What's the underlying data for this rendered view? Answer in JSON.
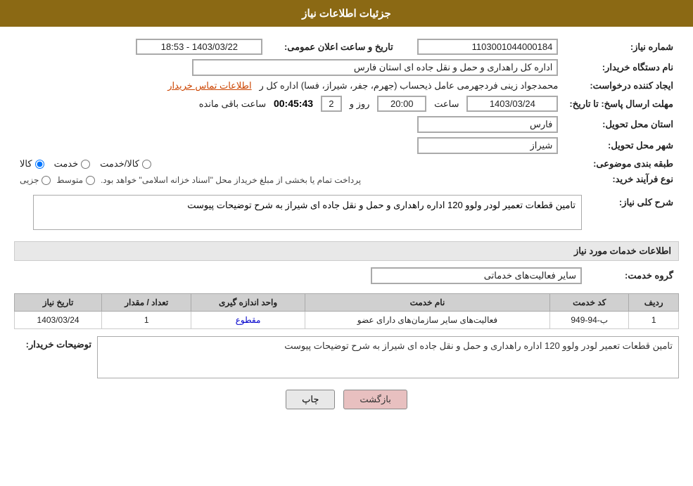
{
  "header": {
    "title": "جزئیات اطلاعات نیاز"
  },
  "fields": {
    "shomareNiaz_label": "شماره نیاز:",
    "shomareNiaz_value": "1103001044000184",
    "namDastgah_label": "نام دستگاه خریدار:",
    "namDastgah_value": "اداره کل راهداری و حمل و نقل جاده ای استان فارس",
    "ijadKonande_label": "ایجاد کننده درخواست:",
    "ijadKonande_value": "محمدجواد زینی فردجهرمی عامل ذیحساب (جهرم، جفر، شیراز، فسا) اداره کل ر",
    "etelaatTamas_label": "اطلاعات تماس خریدار",
    "mohlat_label": "مهلت ارسال پاسخ: تا تاریخ:",
    "date_value": "1403/03/24",
    "saat_label": "ساعت",
    "saat_value": "20:00",
    "roz_label": "روز و",
    "roz_value": "2",
    "baghimande_label": "ساعت باقی مانده",
    "baghimande_value": "00:45:43",
    "ostan_label": "استان محل تحویل:",
    "ostan_value": "فارس",
    "shahr_label": "شهر محل تحویل:",
    "shahr_value": "شیراز",
    "tabaqe_label": "طبقه بندی موضوعی:",
    "tabaqe_radio": [
      {
        "id": "kala",
        "label": "کالا",
        "checked": true
      },
      {
        "id": "khadamat",
        "label": "خدمت",
        "checked": false
      },
      {
        "id": "kala_khadamat",
        "label": "کالا/خدمت",
        "checked": false
      }
    ],
    "noeFarayand_label": "نوع فرآیند خرید:",
    "noeFarayand_radio": [
      {
        "id": "jozii",
        "label": "جزیی",
        "checked": false
      },
      {
        "id": "mootaset",
        "label": "متوسط",
        "checked": false
      }
    ],
    "noeFarayand_desc": "پرداخت تمام یا بخشی از مبلغ خریداز محل \"اسناد خزانه اسلامی\" خواهد بود.",
    "sharhNiaz_label": "شرح کلی نیاز:",
    "sharhNiaz_value": "تامین قطعات تعمیر لودر ولوو 120 اداره راهداری و حمل و نقل جاده ای شیراز به شرح توضیحات پیوست",
    "etelaatKhadamat_title": "اطلاعات خدمات مورد نیاز",
    "gorohKhadamat_label": "گروه خدمت:",
    "gorohKhadamat_value": "سایر فعالیت‌های خدماتی",
    "table": {
      "headers": [
        "ردیف",
        "کد خدمت",
        "نام خدمت",
        "واحد اندازه گیری",
        "تعداد / مقدار",
        "تاریخ نیاز"
      ],
      "rows": [
        {
          "radif": "1",
          "kodKhadamat": "ب-94-949",
          "namKhadamat": "فعالیت‌های سایر سازمان‌های دارای عضو",
          "vahed": "مقطوع",
          "tedad": "1",
          "tarikh": "1403/03/24"
        }
      ]
    },
    "tozihatKharidar_label": "توضیحات خریدار:",
    "tozihatKharidar_value": "تامین قطعات تعمیر لودر ولوو 120 اداره راهداری و حمل و نقل جاده ای شیراز به شرح توضیحات پیوست"
  },
  "buttons": {
    "print_label": "چاپ",
    "back_label": "بازگشت"
  },
  "tarikheAelan_label": "تاریخ و ساعت اعلان عمومی:",
  "tarikheAelan_value": "1403/03/22 - 18:53"
}
